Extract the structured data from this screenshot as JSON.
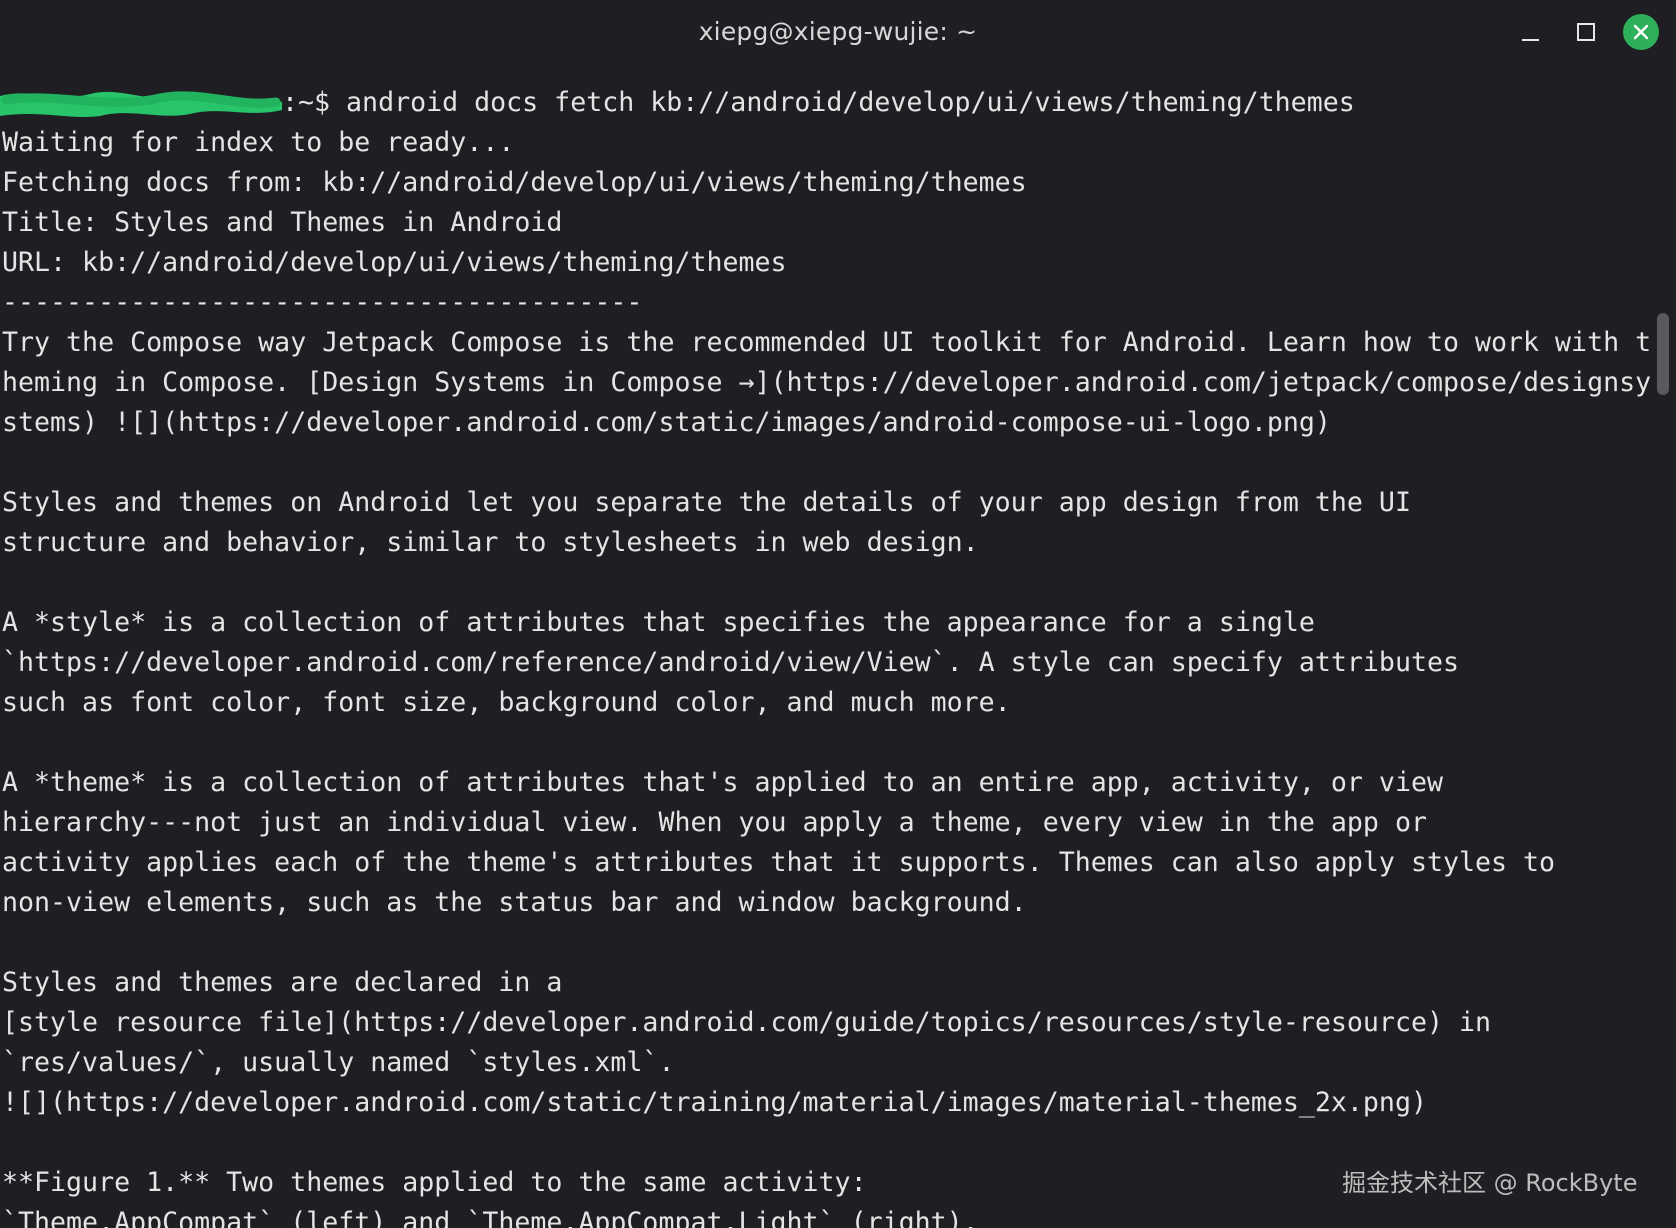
{
  "window": {
    "title": "xiepg@xiepg-wujie: ~"
  },
  "terminal": {
    "prompt_suffix": ":~$ ",
    "command": "android docs fetch kb://android/develop/ui/views/theming/themes",
    "lines": [
      "Waiting for index to be ready...",
      "Fetching docs from: kb://android/develop/ui/views/theming/themes",
      "Title: Styles and Themes in Android",
      "URL: kb://android/develop/ui/views/theming/themes",
      "----------------------------------------",
      "Try the Compose way Jetpack Compose is the recommended UI toolkit for Android. Learn how to work with t",
      "heming in Compose. [Design Systems in Compose →](https://developer.android.com/jetpack/compose/designsy",
      "stems) ![](https://developer.android.com/static/images/android-compose-ui-logo.png)",
      "",
      "Styles and themes on Android let you separate the details of your app design from the UI",
      "structure and behavior, similar to stylesheets in web design.",
      "",
      "A *style* is a collection of attributes that specifies the appearance for a single",
      "`https://developer.android.com/reference/android/view/View`. A style can specify attributes",
      "such as font color, font size, background color, and much more.",
      "",
      "A *theme* is a collection of attributes that's applied to an entire app, activity, or view",
      "hierarchy---not just an individual view. When you apply a theme, every view in the app or",
      "activity applies each of the theme's attributes that it supports. Themes can also apply styles to",
      "non-view elements, such as the status bar and window background.",
      "",
      "Styles and themes are declared in a",
      "[style resource file](https://developer.android.com/guide/topics/resources/style-resource) in",
      "`res/values/`, usually named `styles.xml`.",
      "![](https://developer.android.com/static/training/material/images/material-themes_2x.png)",
      "",
      "**Figure 1.** Two themes applied to the same activity:",
      "`Theme.AppCompat` (left) and `Theme.AppCompat.Light` (right)."
    ]
  },
  "watermark": "掘金技术社区 @ RockByte",
  "icons": {
    "minimize": "minimize-icon",
    "maximize": "maximize-icon",
    "close": "close-icon"
  },
  "colors": {
    "background": "#1f1f23",
    "text": "#e4e4e4",
    "close_button": "#2eb05b",
    "redaction": "#27c46a"
  }
}
